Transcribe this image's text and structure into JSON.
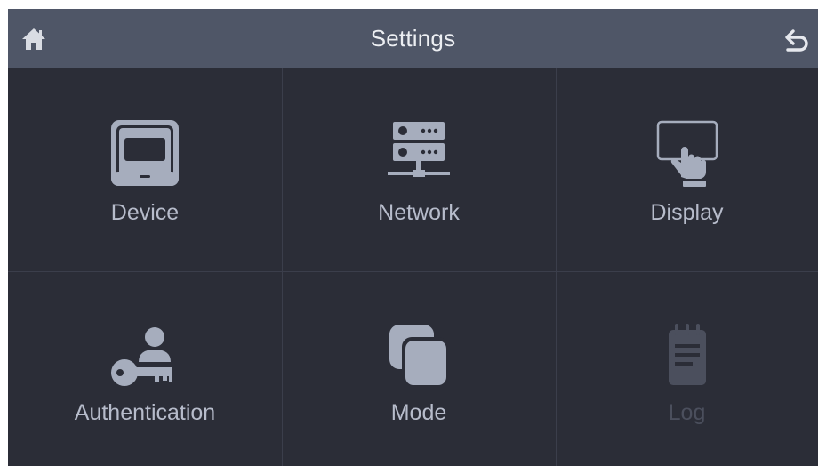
{
  "header": {
    "title": "Settings",
    "home_icon": "home-icon",
    "back_icon": "back-arrow-icon"
  },
  "tiles": [
    {
      "label": "Device",
      "icon": "device-icon",
      "enabled": true
    },
    {
      "label": "Network",
      "icon": "server-network-icon",
      "enabled": true
    },
    {
      "label": "Display",
      "icon": "touch-display-icon",
      "enabled": true
    },
    {
      "label": "Authentication",
      "icon": "key-user-icon",
      "enabled": true
    },
    {
      "label": "Mode",
      "icon": "mode-layers-icon",
      "enabled": true
    },
    {
      "label": "Log",
      "icon": "notepad-log-icon",
      "enabled": false
    }
  ],
  "colors": {
    "background": "#2b2d37",
    "header": "#4f5667",
    "icon": "#a6adbd",
    "label": "#b7bccb",
    "disabled": "#4b4f5d"
  }
}
